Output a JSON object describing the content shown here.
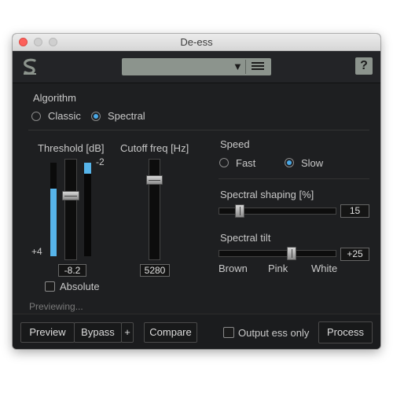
{
  "window": {
    "title": "De-ess"
  },
  "header": {
    "preset_arrow": "▼",
    "help_label": "?"
  },
  "algorithm": {
    "label": "Algorithm",
    "options": [
      "Classic",
      "Spectral"
    ],
    "selected": "Spectral"
  },
  "threshold": {
    "label": "Threshold [dB]",
    "value": "-8.2",
    "top_marker": "-2",
    "bottom_marker": "+4",
    "meter_level": 0.72
  },
  "cutoff": {
    "label": "Cutoff freq [Hz]",
    "value": "5280"
  },
  "absolute": {
    "label": "Absolute",
    "checked": false
  },
  "speed": {
    "label": "Speed",
    "options": [
      "Fast",
      "Slow"
    ],
    "selected": "Slow"
  },
  "spectral_shaping": {
    "label": "Spectral shaping [%]",
    "value": "15"
  },
  "spectral_tilt": {
    "label": "Spectral tilt",
    "value": "+25",
    "scale": [
      "Brown",
      "Pink",
      "White"
    ]
  },
  "status": {
    "text": "Previewing..."
  },
  "bottom": {
    "preview": "Preview",
    "bypass": "Bypass",
    "bypass_plus": "+",
    "compare": "Compare",
    "output_ess_only": "Output ess only",
    "process": "Process"
  },
  "colors": {
    "accent": "#4aa8e6",
    "panel_bg": "#1e1f21",
    "preset_bg": "#8c948d"
  }
}
